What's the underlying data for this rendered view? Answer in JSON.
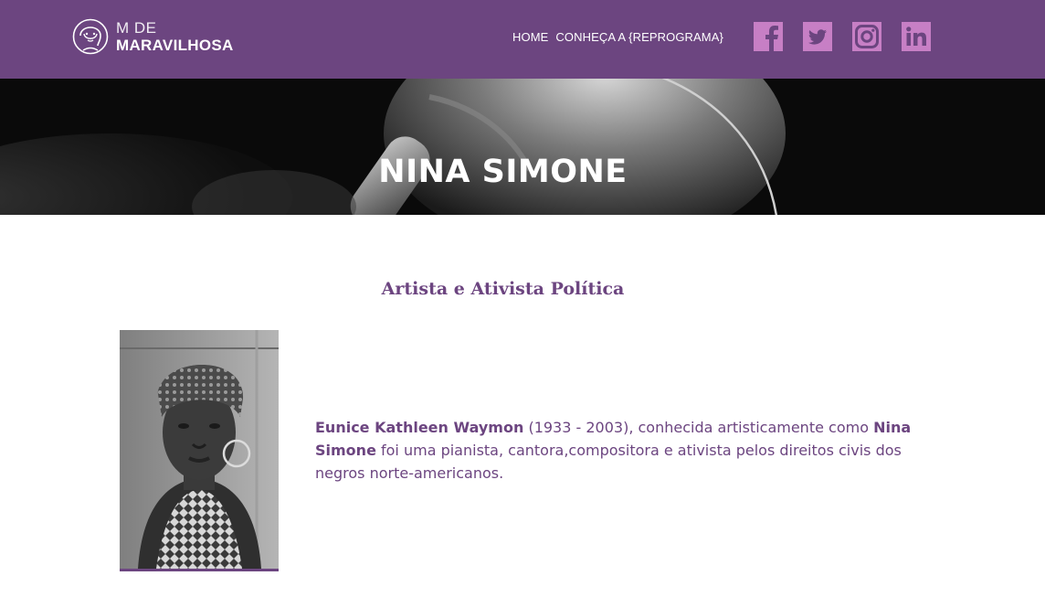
{
  "header": {
    "logo": {
      "line1": "M DE",
      "line2": "MARAVILHOSA"
    },
    "nav": [
      {
        "label": "HOME"
      },
      {
        "label": "CONHEÇA A {REPROGRAMA}"
      }
    ],
    "social": [
      {
        "icon": "facebook-icon"
      },
      {
        "icon": "twitter-icon"
      },
      {
        "icon": "instagram-icon"
      },
      {
        "icon": "linkedin-icon"
      }
    ],
    "colors": {
      "bar": "#6c4580",
      "social": "#c77fc5"
    }
  },
  "hero": {
    "title": "NINA SIMONE"
  },
  "main": {
    "subtitle": "Artista e Ativista Política",
    "bio": {
      "name": "Eunice Kathleen Waymon",
      "years": " (1933 - 2003), conhecida artisticamente como ",
      "stage_name": "Nina Simone",
      "text": " foi uma pianista, cantora,compositora e ativista pelos direitos civis dos negros norte-americanos."
    }
  }
}
